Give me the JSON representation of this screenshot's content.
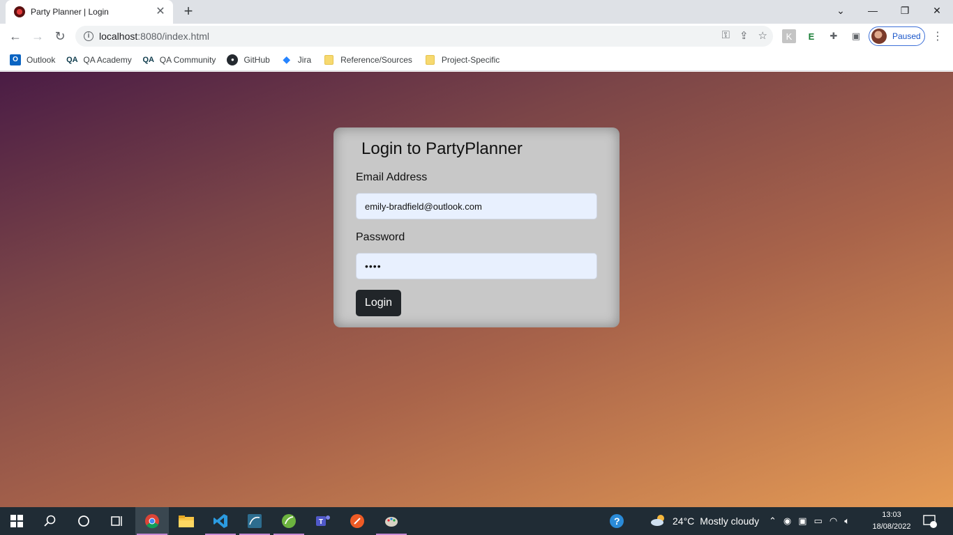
{
  "browser": {
    "tab_title": "Party Planner | Login",
    "url_host": "localhost",
    "url_rest": ":8080/index.html",
    "profile_status": "Paused"
  },
  "bookmarks": [
    {
      "label": "Outlook",
      "icon": "outlook-icon"
    },
    {
      "label": "QA Academy",
      "icon": "qa-icon"
    },
    {
      "label": "QA Community",
      "icon": "qa-icon"
    },
    {
      "label": "GitHub",
      "icon": "github-icon"
    },
    {
      "label": "Jira",
      "icon": "jira-icon"
    },
    {
      "label": "Reference/Sources",
      "icon": "folder-icon"
    },
    {
      "label": "Project-Specific",
      "icon": "folder-icon"
    }
  ],
  "login": {
    "title": "Login to PartyPlanner",
    "email_label": "Email Address",
    "email_value": "emily-bradfield@outlook.com",
    "password_label": "Password",
    "password_value": "••••",
    "button_label": "Login"
  },
  "taskbar": {
    "weather_temp": "24°C",
    "weather_desc": "Mostly cloudy",
    "time": "13:03",
    "date": "18/08/2022",
    "notification_count": "1"
  },
  "colors": {
    "card_bg": "#c8c8c8",
    "button_bg": "#212529",
    "input_bg": "#e8f0fe",
    "gradient_start": "#4a1c45",
    "gradient_end": "#e59b55"
  }
}
